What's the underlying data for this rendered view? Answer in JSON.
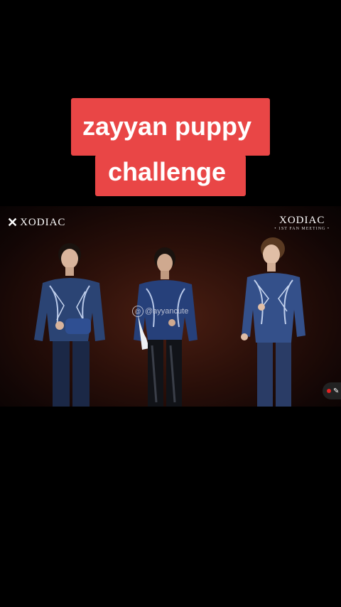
{
  "caption": {
    "line1": "zayyan puppy",
    "line2": "challenge",
    "bg_color": "#e94646"
  },
  "video": {
    "brand_left": "XODIAC",
    "brand_right": "XODIAC",
    "brand_right_sub": "• 1ST FAN MEETING •",
    "watermark": "@ayyancute",
    "live_icon": "record-dot-icon"
  }
}
